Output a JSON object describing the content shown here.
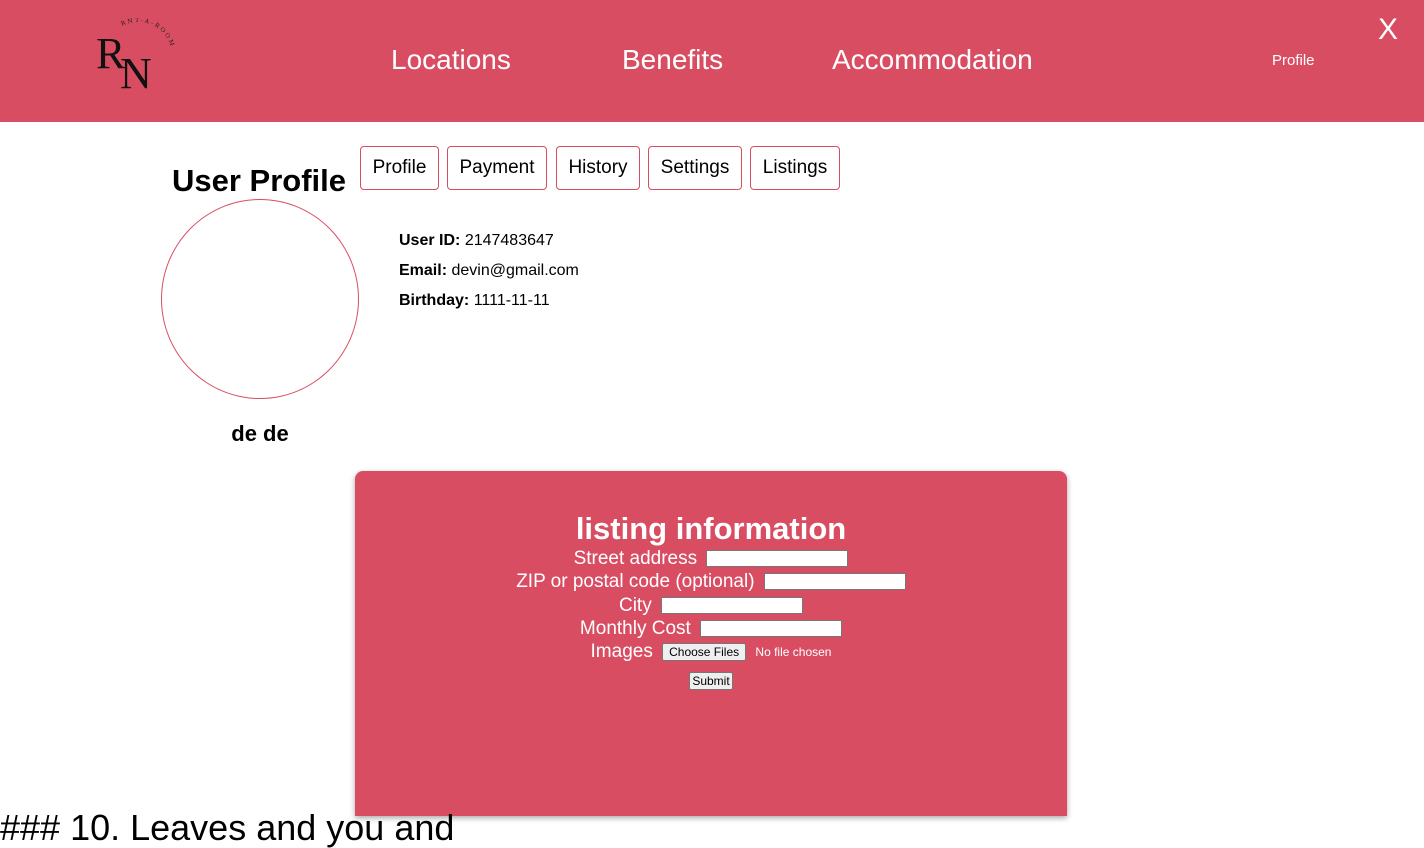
{
  "header": {
    "logo_alt": "RN RNT-A-ROOM",
    "nav": {
      "locations": "Locations",
      "benefits": "Benefits",
      "accommodation": "Accommodation"
    },
    "profile_link": "Profile",
    "close_label": "X"
  },
  "profile": {
    "title": "User Profile",
    "tabs": {
      "profile": "Profile",
      "payment": "Payment",
      "history": "History",
      "settings": "Settings",
      "listings": "Listings"
    },
    "name": "de de",
    "user_id_label": "User ID:",
    "user_id": "2147483647",
    "email_label": "Email:",
    "email": "devin@gmail.com",
    "birthday_label": "Birthday:",
    "birthday": "1111-11-11"
  },
  "listing_form": {
    "title": "listing information",
    "street_label": "Street address",
    "street_value": "",
    "zip_label": "ZIP or postal code (optional)",
    "zip_value": "",
    "city_label": "City",
    "city_value": "",
    "cost_label": "Monthly Cost",
    "cost_value": "",
    "images_label": "Images",
    "choose_files_label": "Choose Files",
    "file_status": "No file chosen",
    "submit_label": "Submit"
  },
  "footer_fragment": "### 10. Leaves and you and"
}
